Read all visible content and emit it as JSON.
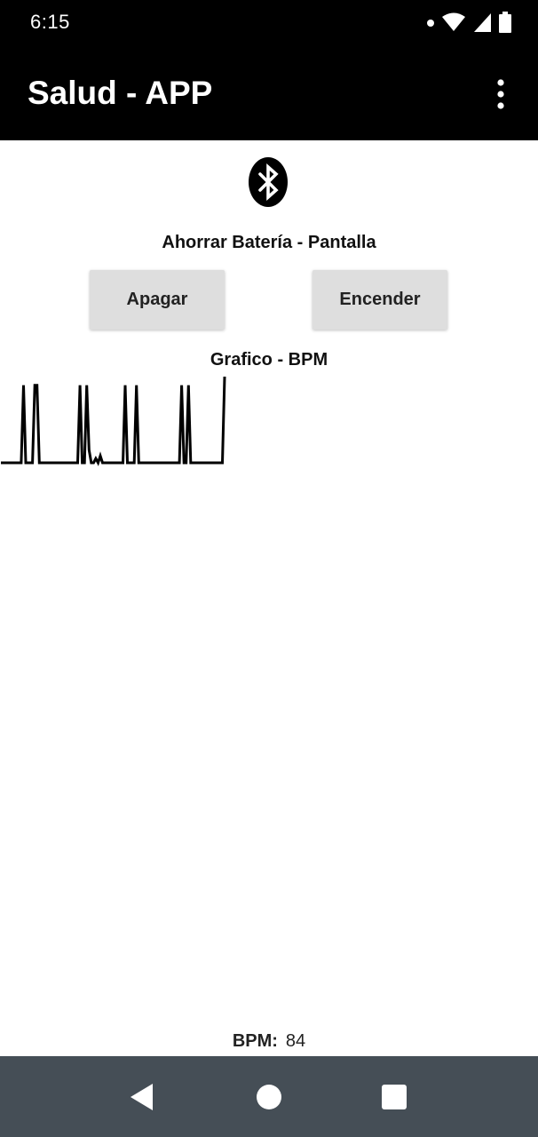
{
  "status_bar": {
    "time": "6:15",
    "icons": [
      "notification-dot-icon",
      "wifi-icon",
      "cellular-signal-icon",
      "battery-icon"
    ]
  },
  "app_bar": {
    "title": "Salud - APP",
    "menu_icon": "more-vert-icon"
  },
  "bluetooth": {
    "icon": "bluetooth-icon"
  },
  "battery_section": {
    "label": "Ahorrar Batería - Pantalla",
    "off_button": "Apagar",
    "on_button": "Encender"
  },
  "chart_section": {
    "title": "Grafico - BPM"
  },
  "chart_data": {
    "type": "line",
    "title": "Grafico - BPM",
    "xlabel": "",
    "ylabel": "",
    "grid": false,
    "series_color": "#000000",
    "note_scale": "relative signal level, 0 = baseline, 1 = peak",
    "y": [
      0,
      0,
      0,
      0,
      0,
      0,
      0,
      0,
      0,
      0,
      0.9,
      0,
      0,
      0,
      0,
      0.9,
      0.9,
      0,
      0,
      0,
      0,
      0,
      0,
      0,
      0,
      0,
      0,
      0,
      0,
      0,
      0,
      0,
      0,
      0,
      0,
      0.9,
      0,
      0,
      0.9,
      0.15,
      0,
      0,
      0.05,
      0,
      0.08,
      0,
      0,
      0,
      0,
      0,
      0,
      0,
      0,
      0,
      0,
      0.9,
      0,
      0,
      0,
      0,
      0.9,
      0,
      0,
      0,
      0,
      0,
      0,
      0,
      0,
      0,
      0,
      0,
      0,
      0,
      0,
      0,
      0,
      0,
      0,
      0,
      0.9,
      0,
      0,
      0.9,
      0,
      0,
      0,
      0,
      0,
      0,
      0,
      0,
      0,
      0,
      0,
      0,
      0,
      0,
      0,
      1.0
    ]
  },
  "bpm": {
    "label": "BPM:",
    "value": "84"
  },
  "nav_bar": {
    "back_icon": "back-triangle-icon",
    "home_icon": "home-circle-icon",
    "recents_icon": "recents-square-icon"
  },
  "colors": {
    "app_bar": "#000000",
    "button_bg": "#dedede",
    "nav_bar": "#454e56",
    "chart_line": "#000000"
  }
}
